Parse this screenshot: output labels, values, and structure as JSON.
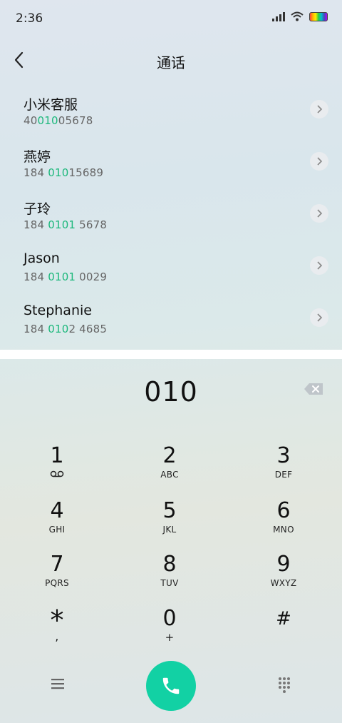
{
  "status_bar": {
    "time": "2:36"
  },
  "header": {
    "title": "通话"
  },
  "results": [
    {
      "name": "小米客服",
      "number_pre": "40",
      "number_match": "010",
      "number_post": "05678"
    },
    {
      "name": "燕婷",
      "number_pre": "184 ",
      "number_match": "010",
      "number_post": "15689"
    },
    {
      "name": "子玲",
      "number_pre": "184 ",
      "number_match": "0101",
      "number_post": " 5678"
    },
    {
      "name": "Jason",
      "number_pre": "184 ",
      "number_match": "0101",
      "number_post": " 0029"
    },
    {
      "name": "Stephanie",
      "number_pre": "184 ",
      "number_match": "010",
      "number_post": "2 4685"
    }
  ],
  "dialer": {
    "number": "010"
  },
  "keys": [
    {
      "digit": "1",
      "letters": ""
    },
    {
      "digit": "2",
      "letters": "ABC"
    },
    {
      "digit": "3",
      "letters": "DEF"
    },
    {
      "digit": "4",
      "letters": "GHI"
    },
    {
      "digit": "5",
      "letters": "JKL"
    },
    {
      "digit": "6",
      "letters": "MNO"
    },
    {
      "digit": "7",
      "letters": "PQRS"
    },
    {
      "digit": "8",
      "letters": "TUV"
    },
    {
      "digit": "9",
      "letters": "WXYZ"
    },
    {
      "digit": "*",
      "letters": ","
    },
    {
      "digit": "0",
      "letters": "+"
    },
    {
      "digit": "#",
      "letters": ""
    }
  ],
  "colors": {
    "match_highlight": "#1db87c",
    "call_button": "#12d1a4"
  },
  "icons": {
    "back": "chevron-left-icon",
    "row_action": "chevron-right-icon",
    "backspace": "backspace-icon",
    "voicemail": "voicemail-icon",
    "menu": "menu-icon",
    "call": "phone-icon",
    "keypad": "dialpad-icon"
  }
}
